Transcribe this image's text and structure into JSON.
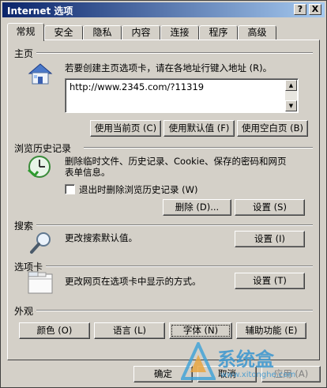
{
  "window": {
    "title": "Internet 选项",
    "help_button": "?",
    "close_button": "X"
  },
  "tabs": [
    {
      "label": "常规",
      "active": true
    },
    {
      "label": "安全"
    },
    {
      "label": "隐私"
    },
    {
      "label": "内容"
    },
    {
      "label": "连接"
    },
    {
      "label": "程序"
    },
    {
      "label": "高级"
    }
  ],
  "home": {
    "title": "主页",
    "desc": "若要创建主页选项卡，请在各地址行键入地址 (R)。",
    "url": "http://www.2345.com/?11319",
    "btn_current": "使用当前页 (C)",
    "btn_default": "使用默认值 (F)",
    "btn_blank": "使用空白页 (B)"
  },
  "history": {
    "title": "浏览历史记录",
    "desc_line1": "删除临时文件、历史记录、Cookie、保存的密码和网页",
    "desc_line2": "表单信息。",
    "checkbox_label": "退出时删除浏览历史记录 (W)",
    "btn_delete": "删除 (D)...",
    "btn_settings": "设置 (S)"
  },
  "search": {
    "title": "搜索",
    "desc": "更改搜索默认值。",
    "btn_settings": "设置 (I)"
  },
  "tabs_section": {
    "title": "选项卡",
    "desc": "更改网页在选项卡中显示的方式。",
    "btn_settings": "设置 (T)"
  },
  "appearance": {
    "title": "外观",
    "btn_colors": "颜色 (O)",
    "btn_languages": "语言 (L)",
    "btn_fonts": "字体 (N)",
    "btn_accessibility": "辅助功能 (E)"
  },
  "footer": {
    "btn_ok": "确定",
    "btn_cancel": "取消",
    "btn_apply": "应用 (A)"
  },
  "watermark": {
    "brand": "系统盒",
    "url": "www.xitonghe.com"
  },
  "colors": {
    "face": "#d4d0c8",
    "title_start": "#0a246a",
    "title_end": "#a6caf0"
  }
}
